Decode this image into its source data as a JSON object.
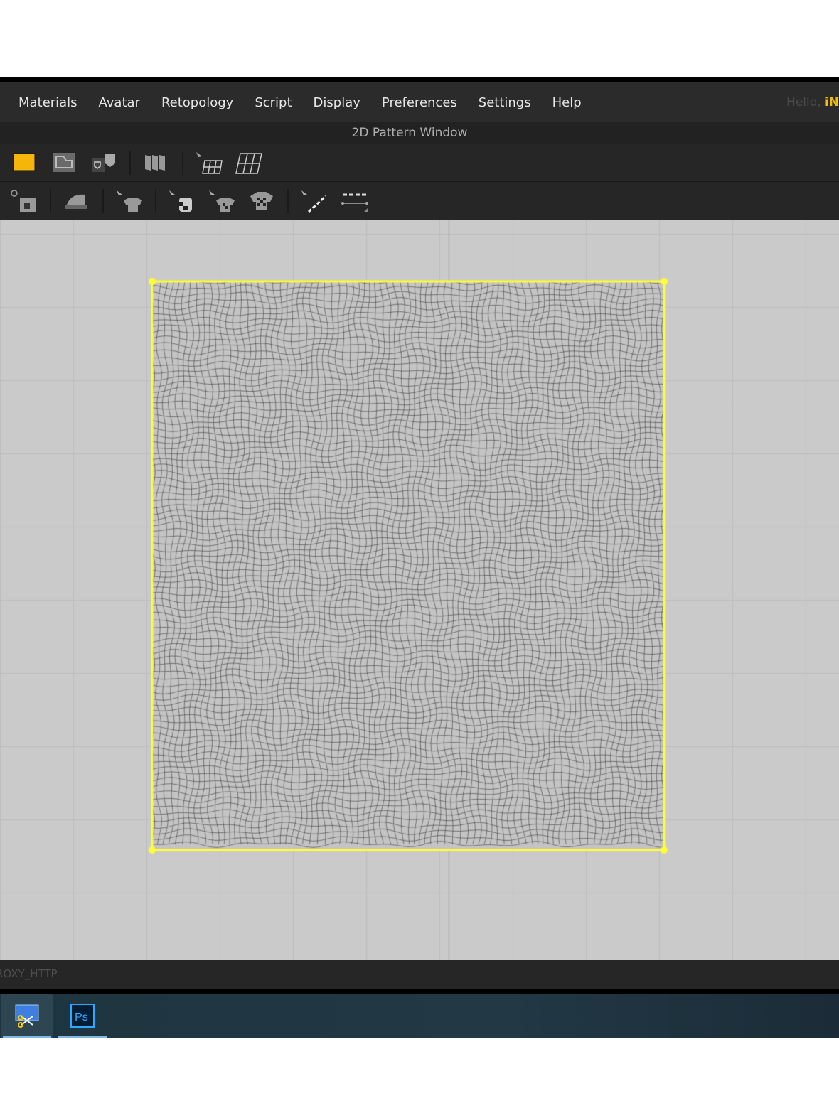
{
  "menu": [
    "Materials",
    "Avatar",
    "Retopology",
    "Script",
    "Display",
    "Preferences",
    "Settings",
    "Help"
  ],
  "greeting": {
    "prefix": "Hello, ",
    "user": "iN"
  },
  "window_title": "2D Pattern Window",
  "toolbar1": [
    "fabric-color-icon",
    "pattern-outline-icon",
    "fold-shape-icon",
    "folding-icon",
    "select-mesh-icon",
    "edit-mesh-icon"
  ],
  "toolbar2": [
    "sewing-machine-icon",
    "iron-icon",
    "select-garment-icon",
    "texture-icon",
    "select-texture-garment-icon",
    "texture-garment-icon",
    "line-icon",
    "measure-icon"
  ],
  "status_text": "ROXY_HTTP",
  "taskbar": [
    "snipping-tool",
    "Ps"
  ],
  "colors": {
    "selection": "#ffff33",
    "accent": "#f2b90f"
  }
}
